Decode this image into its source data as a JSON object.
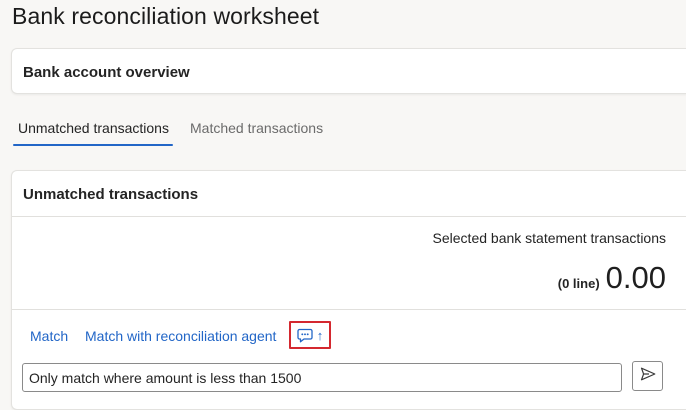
{
  "page": {
    "title": "Bank reconciliation worksheet"
  },
  "overview": {
    "title": "Bank account overview"
  },
  "tabs": [
    {
      "label": "Unmatched transactions",
      "selected": true
    },
    {
      "label": "Matched transactions",
      "selected": false
    }
  ],
  "unmatched": {
    "title": "Unmatched transactions",
    "summary_label": "Selected bank statement transactions",
    "line_count": "(0 line)",
    "amount": "0.00"
  },
  "actions": {
    "match_label": "Match",
    "agent_label": "Match with reconciliation agent",
    "agent_toggle_arrow": "↑",
    "agent_toggle_icon": "chat-icon"
  },
  "prompt": {
    "value": "Only match where amount is less than 1500",
    "send_icon": "send-icon"
  },
  "colors": {
    "accent": "#2266c7",
    "highlight_border": "#d4282f",
    "background": "#f8f7f5"
  }
}
